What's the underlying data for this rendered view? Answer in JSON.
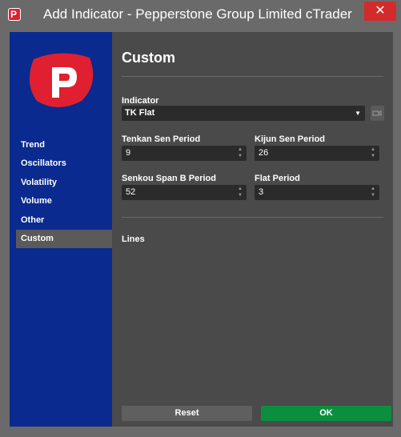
{
  "window": {
    "title": "Add Indicator - Pepperstone Group Limited cTrader",
    "app_icon_letter": "P",
    "close_label": "✕"
  },
  "sidebar": {
    "items": [
      {
        "label": "Trend"
      },
      {
        "label": "Oscillators"
      },
      {
        "label": "Volatility"
      },
      {
        "label": "Volume"
      },
      {
        "label": "Other"
      },
      {
        "label": "Custom",
        "active": true
      }
    ]
  },
  "main": {
    "heading": "Custom",
    "indicator_label": "Indicator",
    "indicator_value": "TK Flat",
    "fields": {
      "tenkan_label": "Tenkan Sen Period",
      "tenkan_value": "9",
      "kijun_label": "Kijun Sen Period",
      "kijun_value": "26",
      "senkou_label": "Senkou Span B Period",
      "senkou_value": "52",
      "flat_label": "Flat Period",
      "flat_value": "3"
    },
    "lines_label": "Lines"
  },
  "footer": {
    "reset_label": "Reset",
    "ok_label": "OK"
  },
  "colors": {
    "sidebar": "#0a2a8f",
    "ok": "#0b8f3f",
    "logo": "#e02030"
  }
}
